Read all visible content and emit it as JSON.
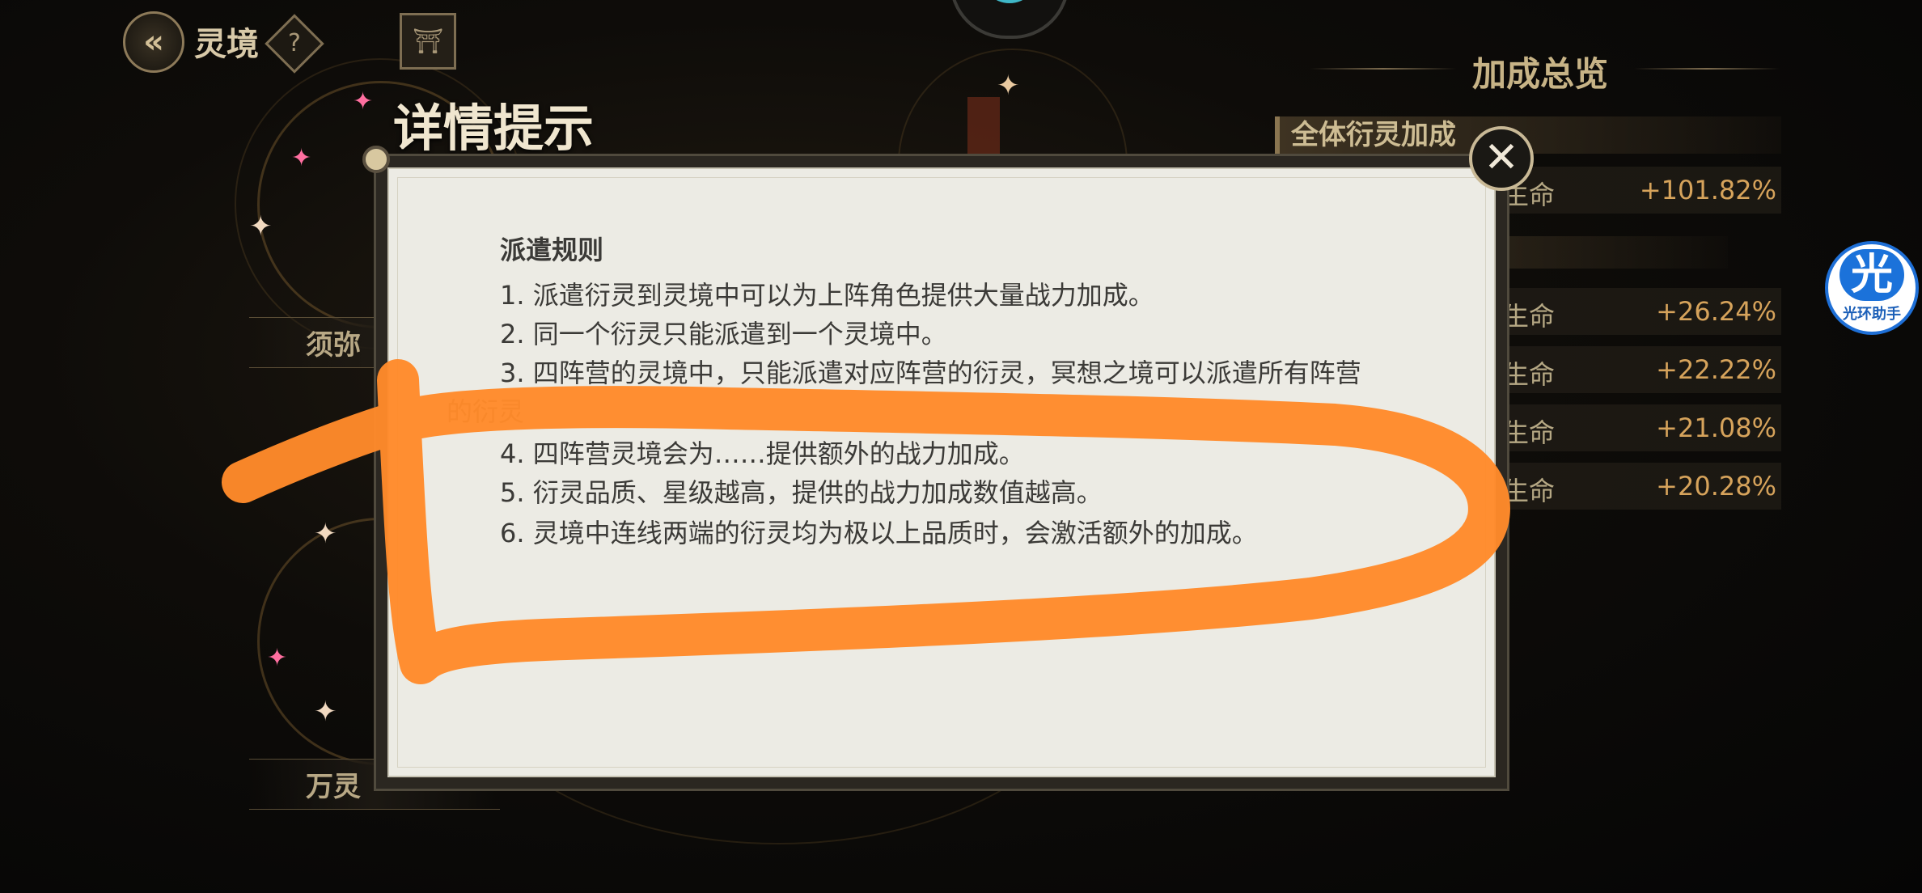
{
  "top_bar": {
    "back_icon": "back-arrow-icon",
    "title": "灵境",
    "help_label": "?",
    "temple_icon": "temple-icon"
  },
  "map": {
    "node_labels": [
      "须弥",
      "万灵"
    ]
  },
  "bonus_panel": {
    "title": "加成总览",
    "section_header": "全体衍灵加成",
    "rows": [
      {
        "label": "生命",
        "value": "+101.82%"
      },
      {
        "label": "生命",
        "value": "+26.24%"
      },
      {
        "label": "生命",
        "value": "+22.22%"
      },
      {
        "label": "生命",
        "value": "+21.08%"
      },
      {
        "label": "生命",
        "value": "+20.28%"
      }
    ]
  },
  "helper_widget": {
    "glyph": "光",
    "caption": "光环助手"
  },
  "dialog": {
    "title": "详情提示",
    "close_icon": "close-icon",
    "heading": "派遣规则",
    "rules": [
      "1. 派遣衍灵到灵境中可以为上阵角色提供大量战力加成。",
      "2. 同一个衍灵只能派遣到一个灵境中。",
      "3. 四阵营的灵境中，只能派遣对应阵营的衍灵，冥想之境可以派遣所有阵营",
      "的衍灵",
      "4. 四阵营灵境会为……提供额外的战力加成。",
      "5. 衍灵品质、星级越高，提供的战力加成数值越高。",
      "6. 灵境中连线两端的衍灵均为极以上品质时，会激活额外的加成。"
    ]
  },
  "colors": {
    "scribble": "#ff8a2a",
    "value_gold": "#d6a35b",
    "dialog_paper": "#ecebe4"
  }
}
